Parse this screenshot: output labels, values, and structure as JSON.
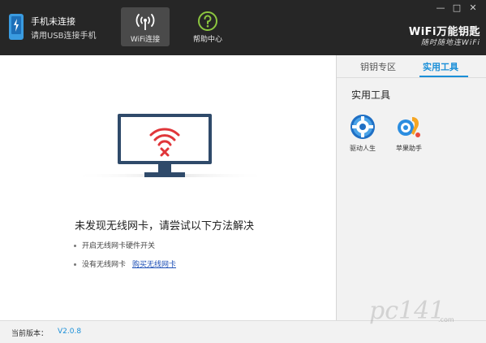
{
  "titlebar": {
    "phone_status": {
      "title": "手机未连接",
      "subtitle": "请用USB连接手机",
      "icon": "usb-phone-icon"
    },
    "nav": [
      {
        "label": "WiFi连接",
        "icon": "wifi-signal-icon",
        "active": true
      },
      {
        "label": "帮助中心",
        "icon": "question-circle-icon",
        "active": false
      }
    ],
    "brand": {
      "title": "WiFi万能钥匙",
      "slogan": "随时随地连WiFi"
    },
    "window_buttons": {
      "minimize": "—",
      "maximize": "□",
      "close": "✕"
    }
  },
  "main": {
    "illustration": "monitor-wifi-error-icon",
    "error_title": "未发现无线网卡，请尝试以下方法解决",
    "tips": [
      {
        "text": "开启无线网卡硬件开关"
      },
      {
        "text": "没有无线网卡",
        "link": "购买无线网卡"
      }
    ]
  },
  "side": {
    "tabs": [
      {
        "label": "钥钥专区",
        "active": false
      },
      {
        "label": "实用工具",
        "active": true
      }
    ],
    "heading": "实用工具",
    "tools": [
      {
        "label": "驱动人生",
        "icon": "gear-globe-icon"
      },
      {
        "label": "苹果助手",
        "icon": "apple-assistant-icon"
      }
    ]
  },
  "footer": {
    "version_label": "当前版本：",
    "version_value": "V2.0.8"
  },
  "watermark": {
    "text": "pc141",
    "sub": ".com"
  },
  "colors": {
    "titlebar": "#262626",
    "accent": "#1a8fd8",
    "error_red": "#e0363a",
    "monitor": "#2f4a6a"
  }
}
